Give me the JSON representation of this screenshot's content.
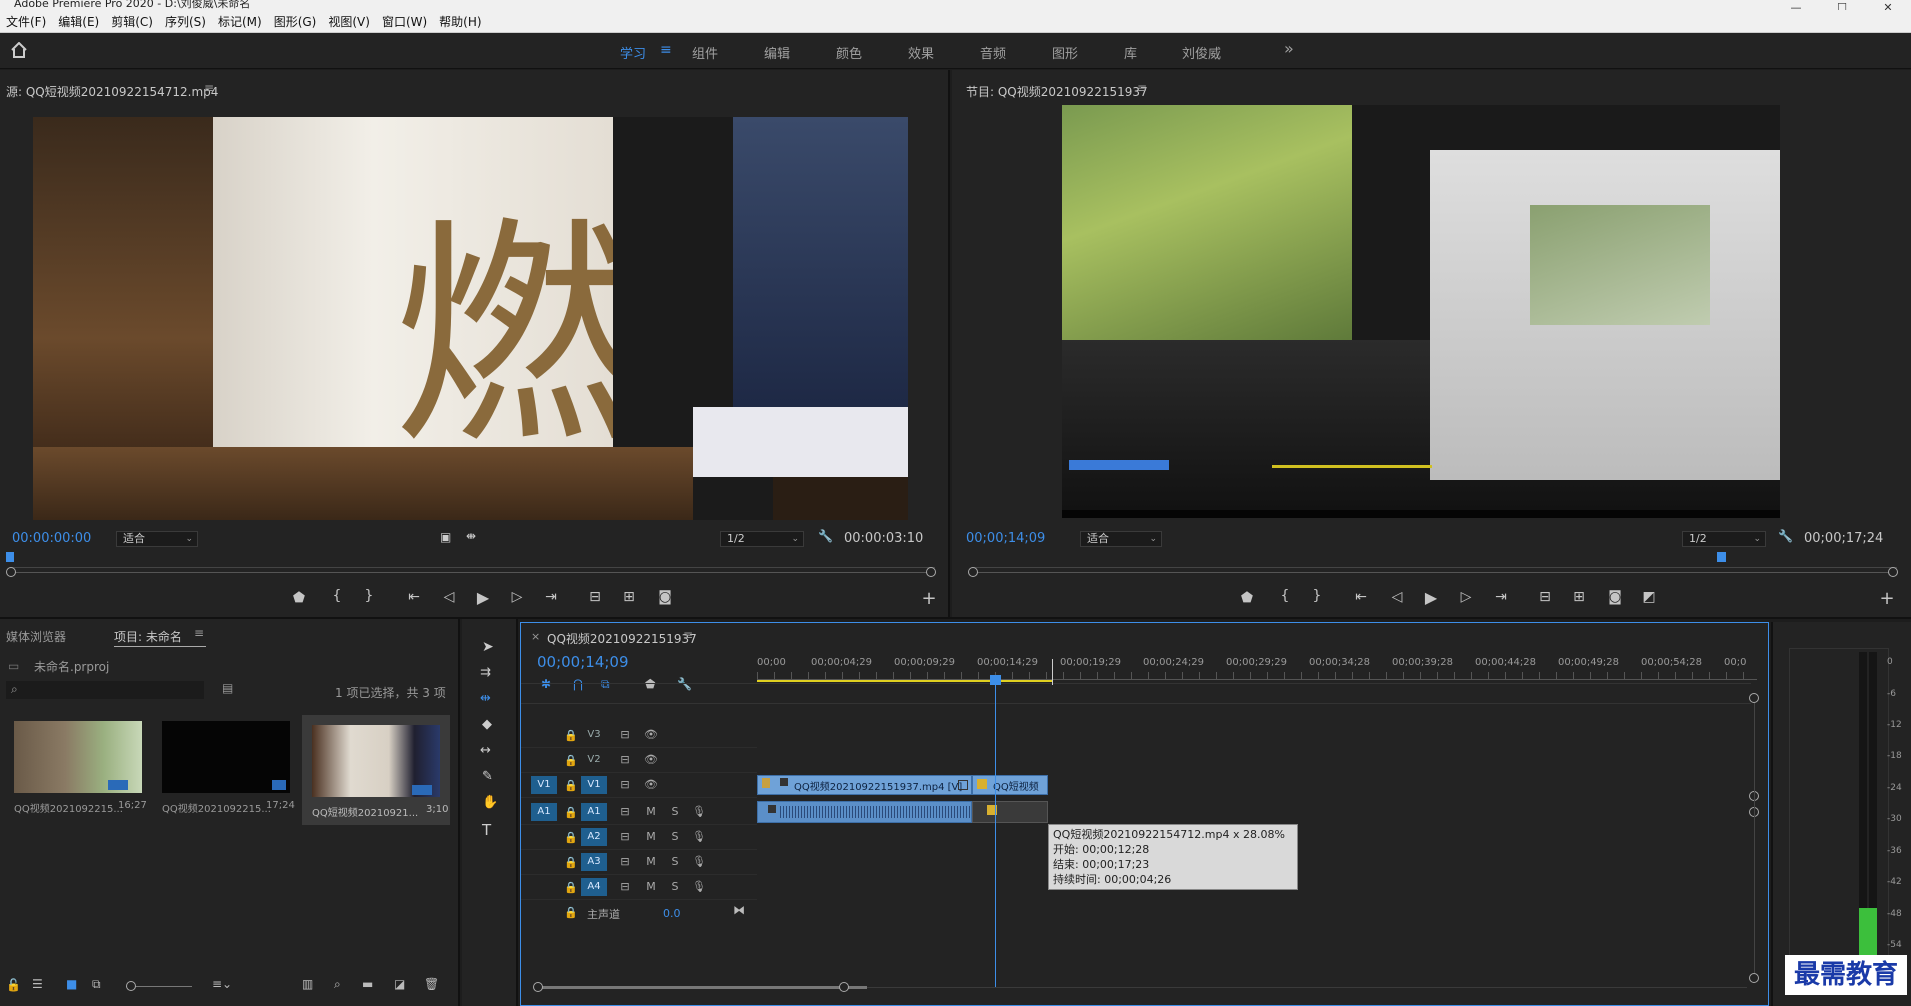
{
  "app": {
    "title": "Adobe Premiere Pro 2020 - D:\\刘俊威\\未命名"
  },
  "menu": [
    "文件(F)",
    "编辑(E)",
    "剪辑(C)",
    "序列(S)",
    "标记(M)",
    "图形(G)",
    "视图(V)",
    "窗口(W)",
    "帮助(H)"
  ],
  "window_controls": [
    "—",
    "☐",
    "✕"
  ],
  "workspace_tabs": [
    {
      "label": "学习",
      "active": true
    },
    {
      "label": "组件"
    },
    {
      "label": "编辑"
    },
    {
      "label": "颜色"
    },
    {
      "label": "效果"
    },
    {
      "label": "音频"
    },
    {
      "label": "图形"
    },
    {
      "label": "库"
    },
    {
      "label": "刘俊威"
    }
  ],
  "workspace_more": "»",
  "source": {
    "title": "源: QQ短视频20210922154712.mp4",
    "timecode": "00:00:00:00",
    "fit": "适合",
    "resolution": "1/2",
    "duration": "00:00:03:10",
    "playhead": 0.0
  },
  "program": {
    "title": "节目: QQ视频20210922151937",
    "timecode": "00;00;14;09",
    "fit": "适合",
    "resolution": "1/2",
    "duration": "00;00;17;24",
    "playhead": 0.81
  },
  "transport_icons": [
    "marker-icon",
    "in-point-icon",
    "out-point-icon",
    "go-to-in-icon",
    "step-back-icon",
    "play-icon",
    "step-forward-icon",
    "go-to-out-icon",
    "insert-icon",
    "overwrite-icon",
    "export-frame-icon"
  ],
  "project": {
    "tabs": [
      "媒体浏览器",
      "项目: 未命名"
    ],
    "active_tab": 1,
    "file": "未命名.prproj",
    "selection_info": "1 项已选择，共 3 项",
    "search_placeholder": "",
    "items": [
      {
        "name": "QQ视频2021092215...",
        "duration": "16;27"
      },
      {
        "name": "QQ视频2021092215...",
        "duration": "17;24"
      },
      {
        "name": "QQ短视频20210921...",
        "duration": "3;10"
      }
    ]
  },
  "timeline": {
    "title": "QQ视频20210922151937",
    "timecode": "00;00;14;09",
    "ruler": [
      "00;00",
      "00;00;04;29",
      "00;00;09;29",
      "00;00;14;29",
      "00;00;19;29",
      "00;00;24;29",
      "00;00;29;29",
      "00;00;34;28",
      "00;00;39;28",
      "00;00;44;28",
      "00;00;49;28",
      "00;00;54;28",
      "00;0"
    ],
    "video_tracks": [
      "V3",
      "V2",
      "V1"
    ],
    "audio_tracks": [
      "A1",
      "A2",
      "A3",
      "A4"
    ],
    "master_label": "主声道",
    "master_value": "0.0",
    "clips": {
      "v1_main": "QQ视频20210922151937.mp4 [V]",
      "v1_second": "QQ短视频"
    },
    "tooltip": {
      "line1": "QQ短视频20210922154712.mp4 x 28.08%",
      "line2": "开始: 00;00;12;28",
      "line3": "结束: 00;00;17;23",
      "line4": "持续时间: 00;00;04;26"
    }
  },
  "meter_labels": [
    "0",
    "-6",
    "-12",
    "-18",
    "-24",
    "-30",
    "-36",
    "-42",
    "-48",
    "-54"
  ],
  "meter_level": 0.2,
  "watermark": "最需教育",
  "colors": {
    "accent": "#3d8ee8",
    "clip_video": "#6fa2d8",
    "clip_audio": "#5b8fc8",
    "tooltip_bg": "#d9d9d9"
  }
}
